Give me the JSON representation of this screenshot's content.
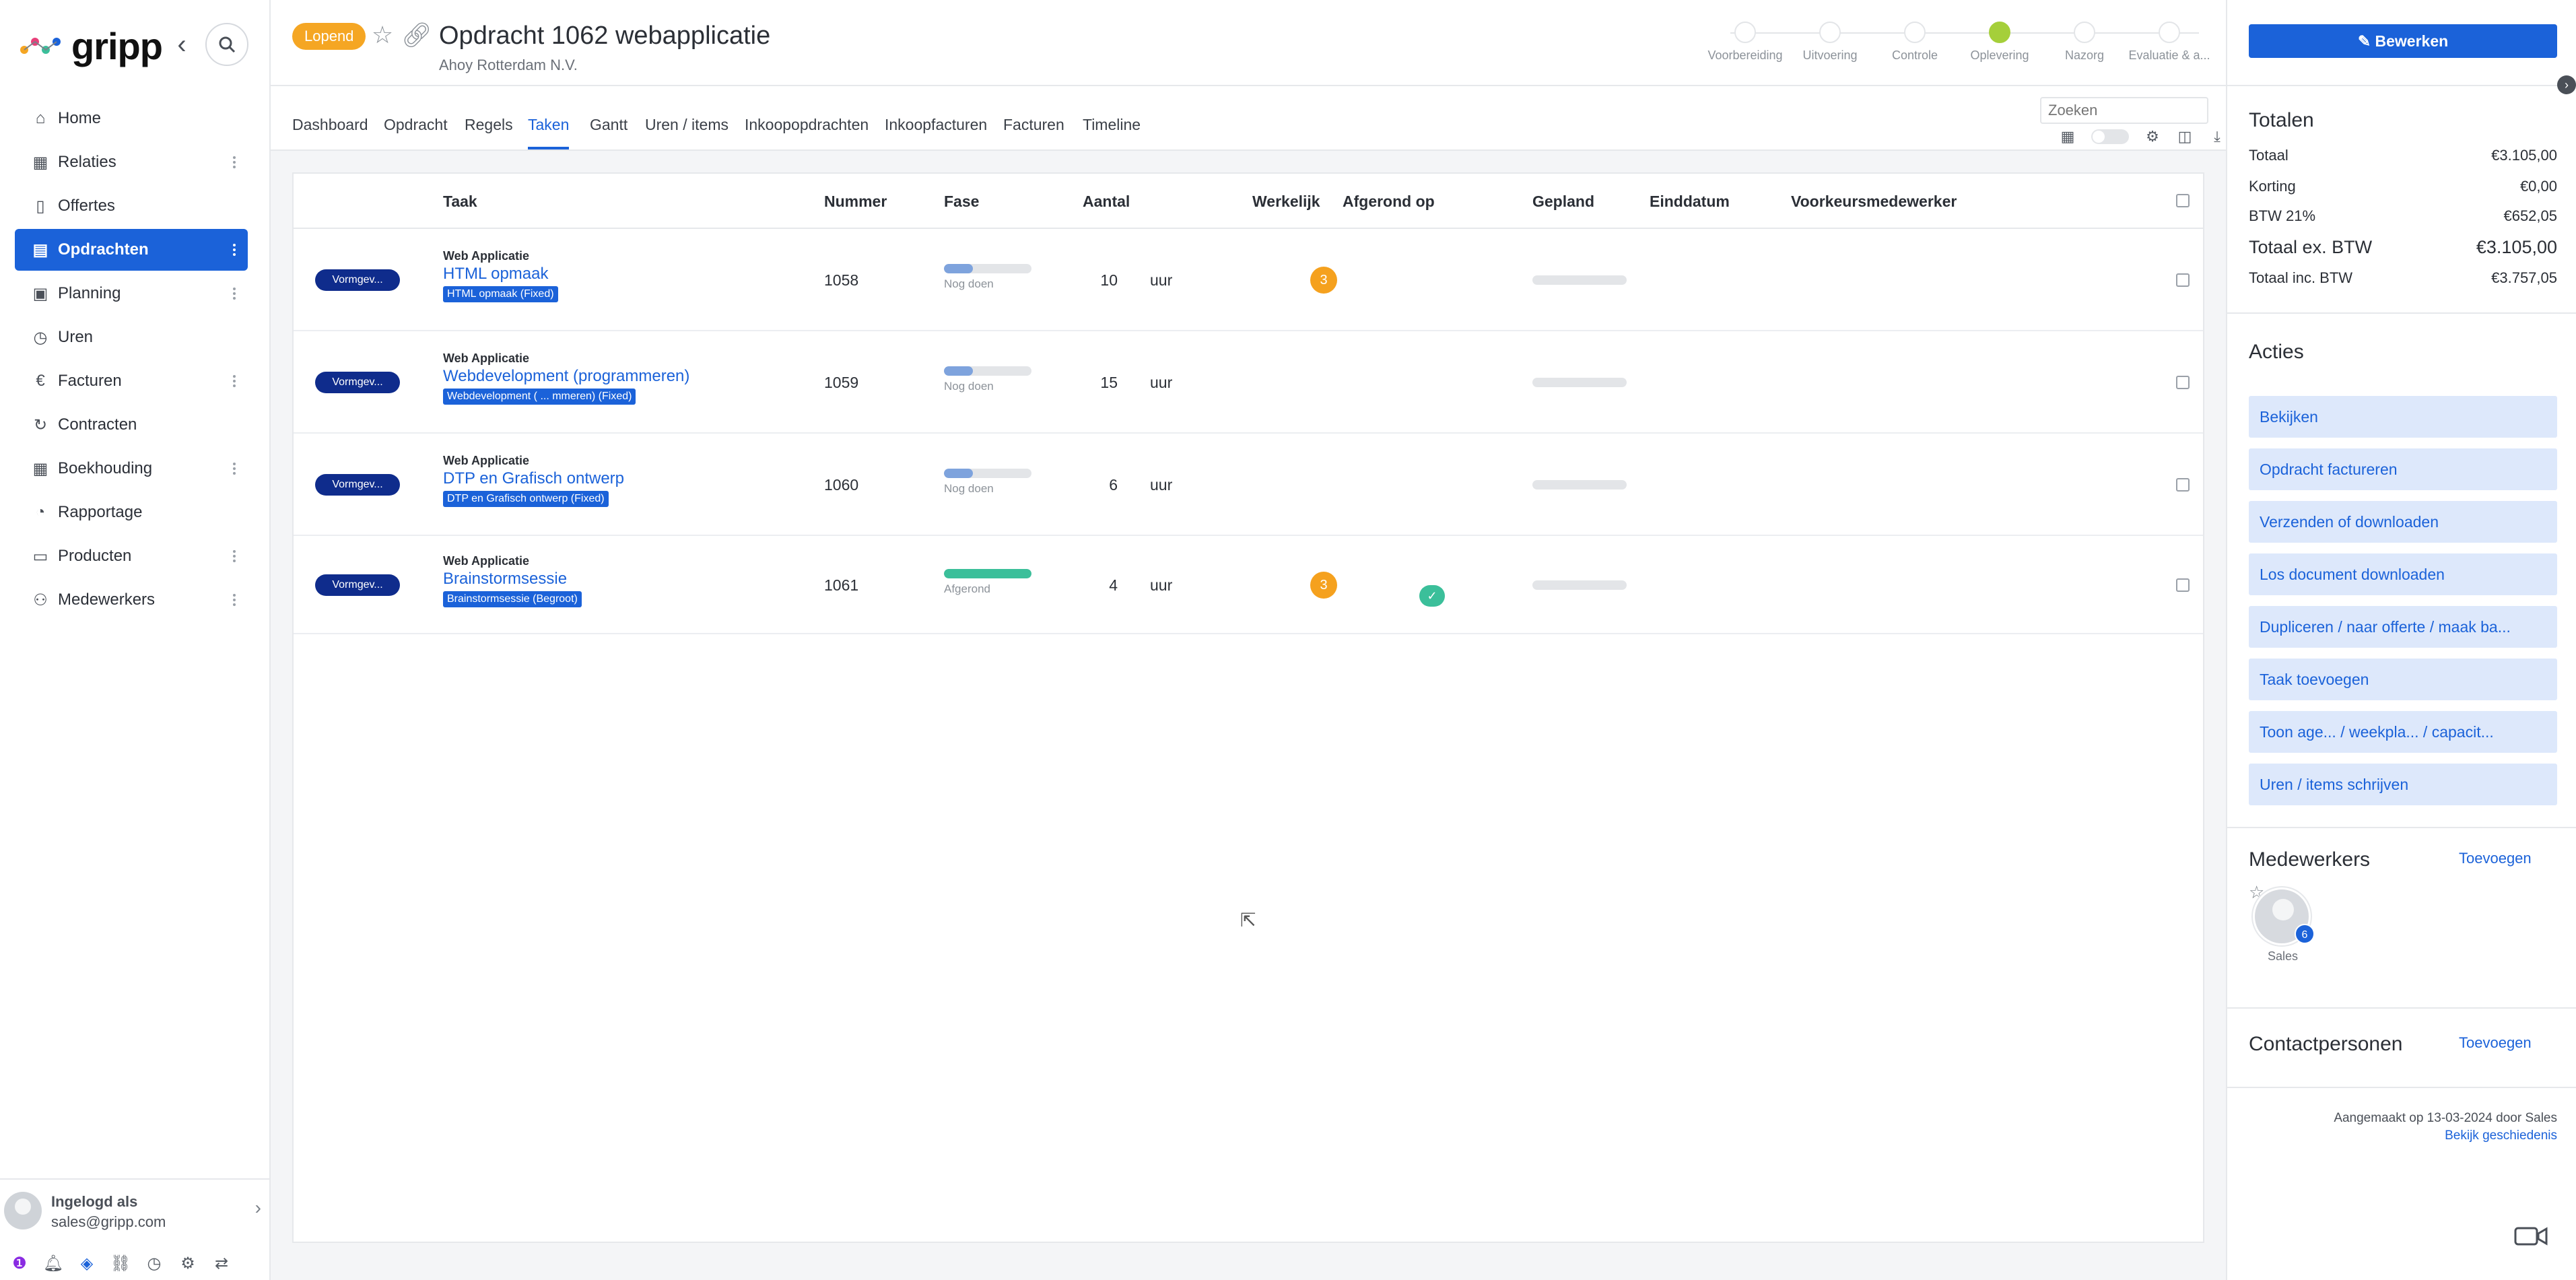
{
  "brand": {
    "name": "gripp"
  },
  "sidebar": {
    "items": [
      {
        "label": "Home",
        "icon": "home-icon",
        "glyph": "⌂",
        "active": false,
        "menu": false
      },
      {
        "label": "Relaties",
        "icon": "building-icon",
        "glyph": "▦",
        "active": false,
        "menu": true
      },
      {
        "label": "Offertes",
        "icon": "document-icon",
        "glyph": "▯",
        "active": false,
        "menu": false
      },
      {
        "label": "Opdrachten",
        "icon": "clipboard-icon",
        "glyph": "▤",
        "active": true,
        "menu": true
      },
      {
        "label": "Planning",
        "icon": "calendar-icon",
        "glyph": "▣",
        "active": false,
        "menu": true
      },
      {
        "label": "Uren",
        "icon": "stopwatch-icon",
        "glyph": "◷",
        "active": false,
        "menu": false
      },
      {
        "label": "Facturen",
        "icon": "euro-icon",
        "glyph": "€",
        "active": false,
        "menu": true
      },
      {
        "label": "Contracten",
        "icon": "refresh-icon",
        "glyph": "↻",
        "active": false,
        "menu": false
      },
      {
        "label": "Boekhouding",
        "icon": "grid-icon",
        "glyph": "▦",
        "active": false,
        "menu": true
      },
      {
        "label": "Rapportage",
        "icon": "pie-chart-icon",
        "glyph": "◔",
        "active": false,
        "menu": false
      },
      {
        "label": "Producten",
        "icon": "box-icon",
        "glyph": "▭",
        "active": false,
        "menu": true
      },
      {
        "label": "Medewerkers",
        "icon": "users-icon",
        "glyph": "⚇",
        "active": false,
        "menu": true
      }
    ],
    "user": {
      "label": "Ingelogd als",
      "email": "sales@gripp.com"
    }
  },
  "header": {
    "status": "Lopend",
    "title": "Opdracht 1062 webapplicatie",
    "subtitle": "Ahoy Rotterdam N.V.",
    "phases": [
      "Voorbereiding",
      "Uitvoering",
      "Controle",
      "Oplevering",
      "Nazorg",
      "Evaluatie & a..."
    ],
    "current_phase": 3
  },
  "tabs": [
    "Dashboard",
    "Opdracht",
    "Regels",
    "Taken",
    "Gantt",
    "Uren / items",
    "Inkoopopdrachten",
    "Inkoopfacturen",
    "Facturen",
    "Timeline"
  ],
  "active_tab": "Taken",
  "search": {
    "placeholder": "Zoeken"
  },
  "table": {
    "columns": {
      "taak": "Taak",
      "nummer": "Nummer",
      "fase": "Fase",
      "aantal": "Aantal",
      "werkelijk": "Werkelijk",
      "afgerond": "Afgerond op",
      "gepland": "Gepland",
      "einddatum": "Einddatum",
      "voorkeur": "Voorkeursmedewerker"
    },
    "rows": [
      {
        "badge": "Vormgev...",
        "parent": "Web Applicatie",
        "name": "HTML opmaak",
        "tag": "HTML opmaak (Fixed)",
        "number": "1058",
        "progress": 0.33,
        "phase": "Nog doen",
        "amount": "10",
        "unit": "uur",
        "actual": "3",
        "done": false
      },
      {
        "badge": "Vormgev...",
        "parent": "Web Applicatie",
        "name": "Webdevelopment (programmeren)",
        "tag": "Webdevelopment ( ... mmeren) (Fixed)",
        "number": "1059",
        "progress": 0.33,
        "phase": "Nog doen",
        "amount": "15",
        "unit": "uur",
        "actual": "",
        "done": false
      },
      {
        "badge": "Vormgev...",
        "parent": "Web Applicatie",
        "name": "DTP en Grafisch ontwerp",
        "tag": "DTP en Grafisch ontwerp (Fixed)",
        "number": "1060",
        "progress": 0.33,
        "phase": "Nog doen",
        "amount": "6",
        "unit": "uur",
        "actual": "",
        "done": false
      },
      {
        "badge": "Vormgev...",
        "parent": "Web Applicatie",
        "name": "Brainstormsessie",
        "tag": "Brainstormsessie (Begroot)",
        "number": "1061",
        "progress": 1.0,
        "phase": "Afgerond",
        "amount": "4",
        "unit": "uur",
        "actual": "3",
        "done": true
      }
    ]
  },
  "right": {
    "edit_label": "Bewerken",
    "totals_title": "Totalen",
    "totals": [
      {
        "label": "Totaal",
        "value": "€3.105,00",
        "big": false
      },
      {
        "label": "Korting",
        "value": "€0,00",
        "big": false
      },
      {
        "label": "BTW 21%",
        "value": "€652,05",
        "big": false
      },
      {
        "label": "Totaal ex. BTW",
        "value": "€3.105,00",
        "big": true
      },
      {
        "label": "Totaal inc. BTW",
        "value": "€3.757,05",
        "big": false
      }
    ],
    "actions_title": "Acties",
    "actions": [
      "Bekijken",
      "Opdracht factureren",
      "Verzenden of downloaden",
      "Los document downloaden",
      "Dupliceren / naar offerte / maak ba...",
      "Taak toevoegen",
      "Toon age...    / weekpla...    / capacit...",
      "Uren / items schrijven"
    ],
    "employees_title": "Medewerkers",
    "employees_add": "Toevoegen",
    "employee": {
      "name": "Sales",
      "count": "6"
    },
    "contacts_title": "Contactpersonen",
    "contacts_add": "Toevoegen",
    "created": "Aangemaakt op 13-03-2024 door Sales",
    "history": "Bekijk geschiedenis"
  },
  "colors": {
    "primary": "#1b62d9",
    "status": "#f5a623",
    "badge": "#0f2c8c",
    "success": "#3bbf9a",
    "warning": "#f5a11e",
    "phase_current": "#a5cf3a"
  }
}
